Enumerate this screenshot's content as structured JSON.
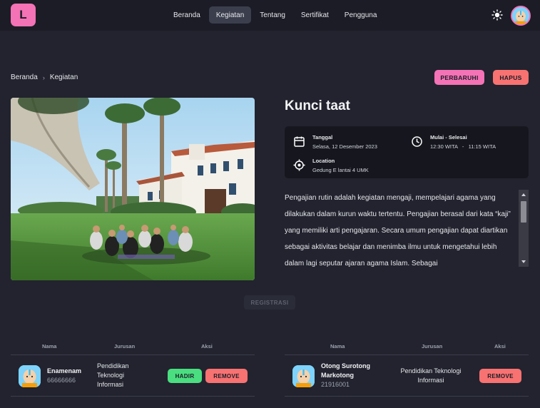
{
  "app": {
    "logo_letter": "L"
  },
  "nav": {
    "items": [
      {
        "label": "Beranda",
        "active": false
      },
      {
        "label": "Kegiatan",
        "active": true
      },
      {
        "label": "Tentang",
        "active": false
      },
      {
        "label": "Sertifikat",
        "active": false
      },
      {
        "label": "Pengguna",
        "active": false
      }
    ]
  },
  "breadcrumb": {
    "home": "Beranda",
    "current": "Kegiatan"
  },
  "actions": {
    "update_label": "PERBARUHI",
    "delete_label": "HAPUS"
  },
  "event": {
    "title": "Kunci taat",
    "date_label": "Tanggal",
    "date_value": "Selasa, 12 Desember 2023",
    "time_label": "Mulai - Selesai",
    "time_value": "12:30 WITA   -   11:15 WITA",
    "location_label": "Location",
    "location_value": "Gedung E lantai 4 UMK",
    "description": "Pengajian rutin adalah kegiatan mengaji, mempelajari agama yang dilakukan dalam kurun waktu tertentu. Pengajian berasal dari kata “kaji” yang memiliki arti pengajaran. Secara umum pengajian dapat diartikan sebagai aktivitas belajar dan menimba ilmu untuk mengetahui lebih dalam lagi seputar ajaran agama Islam. Sebagai",
    "register_label": "REGISTRASI"
  },
  "tables": {
    "headers": {
      "name": "Nama",
      "major": "Jurusan",
      "action": "Aksi"
    },
    "left": [
      {
        "name": "Enamenam",
        "id": "66666666",
        "major_lines": [
          "Pendidikan",
          "Teknologi",
          "Informasi"
        ],
        "hadir_label": "HADIR",
        "remove_label": "REMOVE"
      }
    ],
    "right": [
      {
        "name_lines": [
          "Otong Surotong",
          "Markotong"
        ],
        "id": "21916001",
        "major_lines": [
          "Pendidikan Teknologi",
          "Informasi"
        ],
        "remove_label": "REMOVE"
      }
    ]
  },
  "colors": {
    "accent": "#f472b6",
    "danger": "#f87272",
    "success": "#4ade80",
    "background": "#22232e",
    "navbar": "#1b1c25"
  },
  "icons": {
    "theme": "sun-icon",
    "date": "calendar-icon",
    "time": "clock-icon",
    "location": "location-target-icon"
  }
}
